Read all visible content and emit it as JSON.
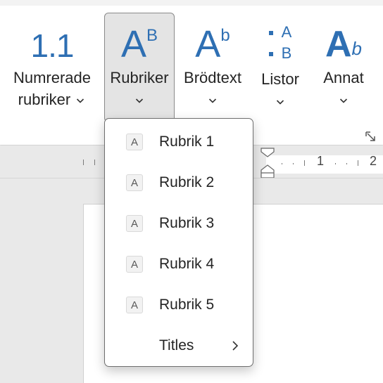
{
  "ribbon": {
    "buttons": [
      {
        "icon": "1.1",
        "label1": "Numrerade",
        "label2": "rubriker"
      },
      {
        "icon_main": "A",
        "icon_sup": "B",
        "label1": "Rubriker"
      },
      {
        "icon_main": "A",
        "icon_sup": "b",
        "label1": "Brödtext"
      },
      {
        "icon_a": "A",
        "icon_b": "B",
        "label1": "Listor"
      },
      {
        "icon_main": "A",
        "icon_sub": "b",
        "label1": "Annat"
      }
    ]
  },
  "ruler": {
    "numbers": [
      "1",
      "2"
    ]
  },
  "dropdown": {
    "items": [
      {
        "icon": "A",
        "label": "Rubrik 1"
      },
      {
        "icon": "A",
        "label": "Rubrik 2"
      },
      {
        "icon": "A",
        "label": "Rubrik 3"
      },
      {
        "icon": "A",
        "label": "Rubrik 4"
      },
      {
        "icon": "A",
        "label": "Rubrik 5"
      }
    ],
    "submenu": {
      "label": "Titles"
    }
  },
  "colors": {
    "accent": "#2e6fb3",
    "active_bg": "#e4e4e4"
  }
}
